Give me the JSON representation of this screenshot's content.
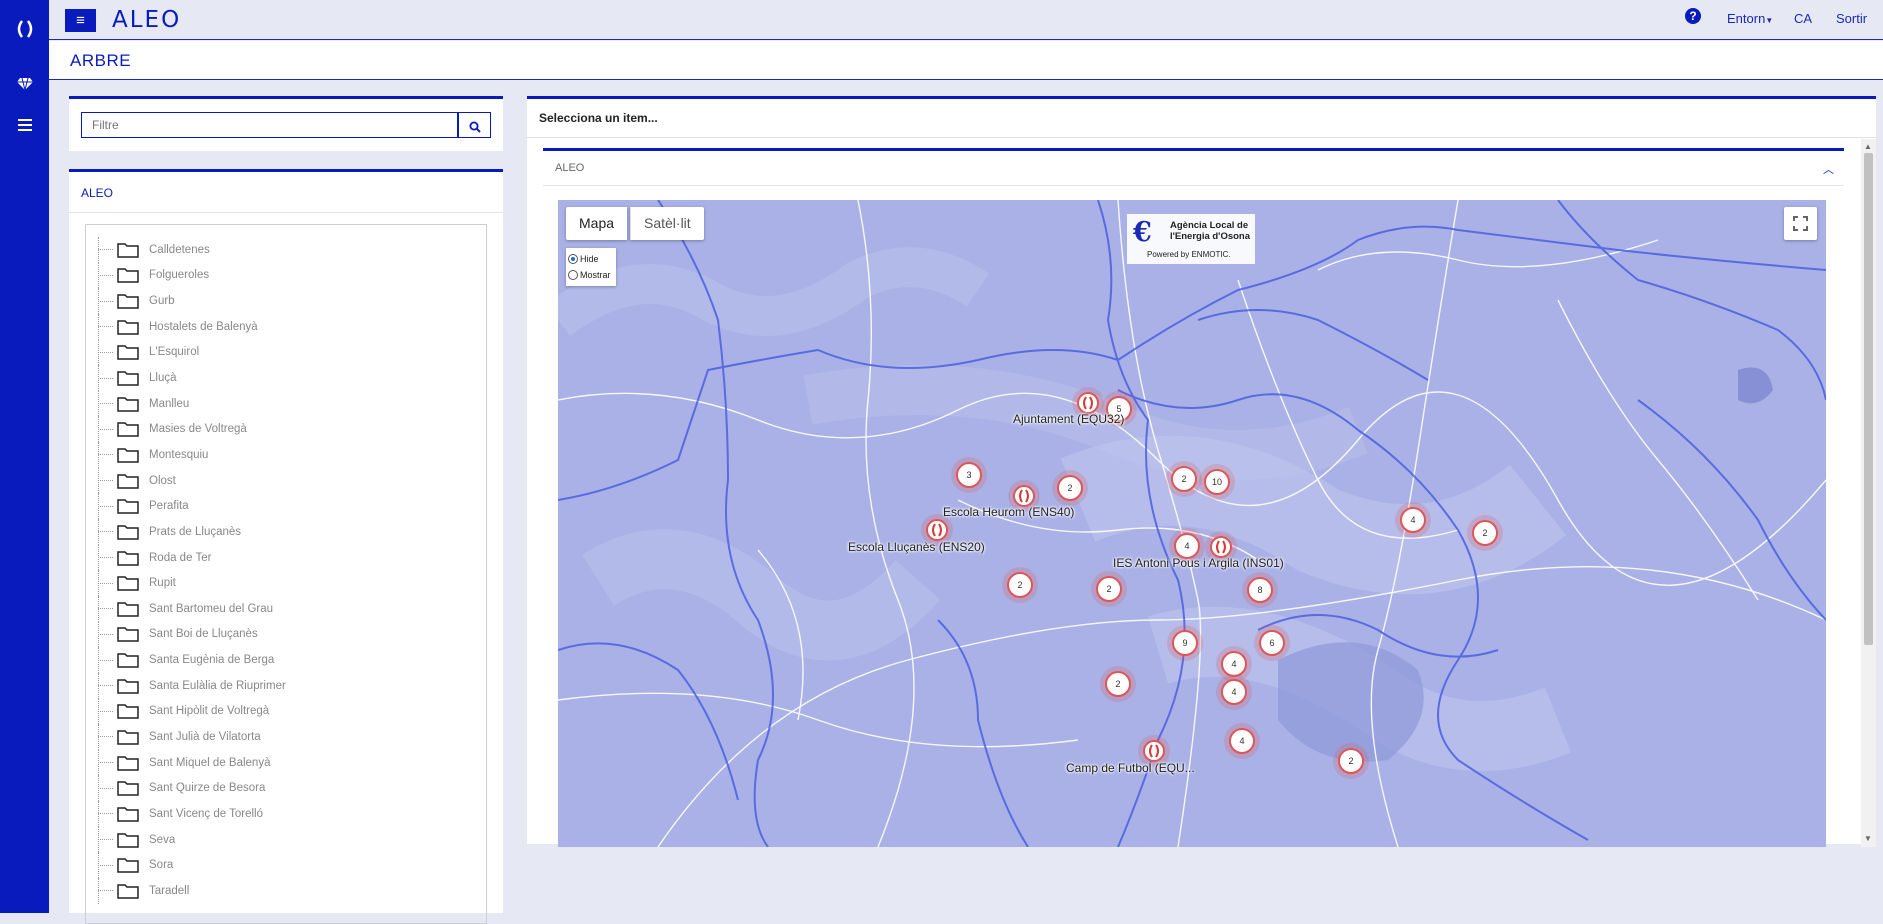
{
  "app": {
    "title": "ALEO",
    "menu_icon": "hamburger-icon"
  },
  "top_nav": {
    "help_icon": "question-circle-icon",
    "entorn_label": "Entorn",
    "language_label": "CA",
    "logout_label": "Sortir"
  },
  "page": {
    "title": "ARBRE"
  },
  "filter": {
    "placeholder": "Filtre",
    "search_icon": "search-icon"
  },
  "tree": {
    "title": "ALEO",
    "items": [
      "Calldetenes",
      "Folgueroles",
      "Gurb",
      "Hostalets de Balenyà",
      "L'Esquirol",
      "Lluçà",
      "Manlleu",
      "Masies de Voltregà",
      "Montesquiu",
      "Olost",
      "Perafita",
      "Prats de Lluçanès",
      "Roda de Ter",
      "Rupit",
      "Sant Bartomeu del Grau",
      "Sant Boi de Lluçanès",
      "Santa Eugènia de Berga",
      "Santa Eulàlia de Riuprimer",
      "Sant Hipòlit de Voltregà",
      "Sant Julià de Vilatorta",
      "Sant Miquel de Balenyà",
      "Sant Quirze de Besora",
      "Sant Vicenç de Torelló",
      "Seva",
      "Sora",
      "Taradell"
    ]
  },
  "main": {
    "select_prompt": "Selecciona un item...",
    "section_title": "ALEO"
  },
  "map": {
    "type_buttons": {
      "map": "Mapa",
      "satellite": "Satèl·lit"
    },
    "radio": {
      "hide": "Hide",
      "show": "Mostrar",
      "selected": "Hide"
    },
    "logo": {
      "line1": "Agència Local de",
      "line2": "l'Energia d'Osona",
      "powered": "Powered by ENMOTIC."
    },
    "clusters": [
      {
        "count": "5"
      },
      {
        "count": "3"
      },
      {
        "count": "2"
      },
      {
        "count": "2"
      },
      {
        "count": "10"
      },
      {
        "count": "4"
      },
      {
        "count": "2"
      },
      {
        "count": "4"
      },
      {
        "count": "2"
      },
      {
        "count": "2"
      },
      {
        "count": "8"
      },
      {
        "count": "9"
      },
      {
        "count": "6"
      },
      {
        "count": "4"
      },
      {
        "count": "4"
      },
      {
        "count": "2"
      },
      {
        "count": "4"
      },
      {
        "count": "2"
      }
    ],
    "markers": [
      {
        "label": "Ajuntament (EQU32)"
      },
      {
        "label": "Escola Heurom (ENS40)"
      },
      {
        "label": "Escola Lluçanès (ENS20)"
      },
      {
        "label": "IES Antoni Pous i Argila (INS01)"
      },
      {
        "label": "Camp de Futbol (EQU..."
      }
    ]
  },
  "colors": {
    "accent": "#0a1bbd",
    "map_base": "#aab2e6",
    "cluster_ring": "#e05555"
  }
}
